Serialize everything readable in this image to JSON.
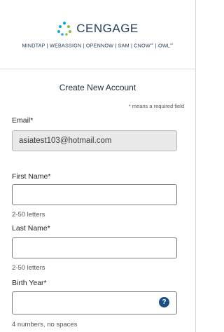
{
  "brand": {
    "name": "CENGAGE",
    "products": [
      "MINDTAP",
      "WEBASSIGN",
      "OPENNOW",
      "SAM",
      "CNOW",
      "OWL"
    ],
    "product_marks": {
      "CNOW": "v2",
      "OWL": "v2"
    }
  },
  "page_title": "Create New Account",
  "required_note": "* means a required field",
  "fields": {
    "email": {
      "label": "Email*",
      "value": "asiatest103@hotmail.com"
    },
    "first_name": {
      "label": "First Name*",
      "value": "",
      "hint": "2-50 letters"
    },
    "last_name": {
      "label": "Last Name*",
      "value": "",
      "hint": "2-50 letters"
    },
    "birth_year": {
      "label": "Birth Year*",
      "value": "",
      "hint": "4 numbers, no spaces",
      "help_icon": "question-icon",
      "help_glyph": "?"
    }
  },
  "colors": {
    "brand_dark": "#1f3a55",
    "help_icon": "#1d4f86",
    "disabled_field": "#e9e9e9",
    "logo_cyan": "#17a7d6",
    "logo_green": "#7cc242"
  }
}
